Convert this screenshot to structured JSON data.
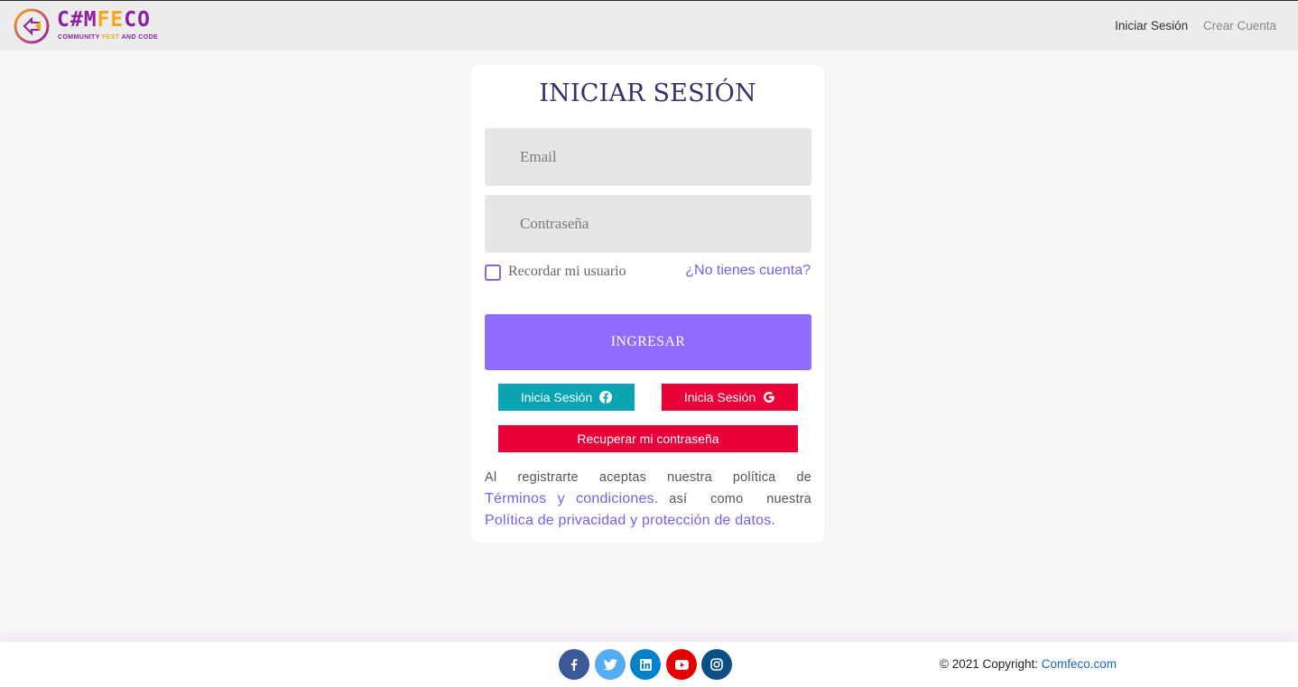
{
  "brand": {
    "title_main": "C#M",
    "title_accent": "FE",
    "title_end": "CO",
    "sub_main": "COMMUNITY ",
    "sub_accent": "FEST",
    "sub_end": " AND CODE",
    "primary_color": "#8e1da7",
    "accent_color": "#f2a81d"
  },
  "nav": {
    "login": "Iniciar Sesión",
    "signup": "Crear Cuenta"
  },
  "login": {
    "title": "INICIAR SESIÓN",
    "email_placeholder": "Email",
    "password_placeholder": "Contraseña",
    "remember_label": "Recordar mi usuario",
    "no_account_link": "¿No tienes cuenta?",
    "submit_label": "INGRESAR",
    "facebook_label": "Inicia Sesión",
    "google_label": "Inicia Sesión",
    "recover_label": "Recuperar mi contraseña",
    "terms_text_1": "Al registrarte aceptas nuestra política de",
    "terms_link": "Términos y condiciones.",
    "terms_text_2": "así como nuestra",
    "privacy_link": "Política de privacidad y protección de datos."
  },
  "footer": {
    "social": [
      {
        "name": "facebook-icon",
        "color": "#3b5998"
      },
      {
        "name": "twitter-icon",
        "color": "#55acee"
      },
      {
        "name": "linkedin-icon",
        "color": "#0082ca"
      },
      {
        "name": "youtube-icon",
        "color": "#ed302f"
      },
      {
        "name": "instagram-icon",
        "color": "#0b4f86"
      }
    ],
    "copyright_text": "© 2021 Copyright: ",
    "copyright_link": "Comfeco.com"
  },
  "colors": {
    "primary_button": "#8f6cfc",
    "facebook_button": "#08a4b4",
    "danger_button": "#ea0038",
    "link": "#7b5cec"
  }
}
